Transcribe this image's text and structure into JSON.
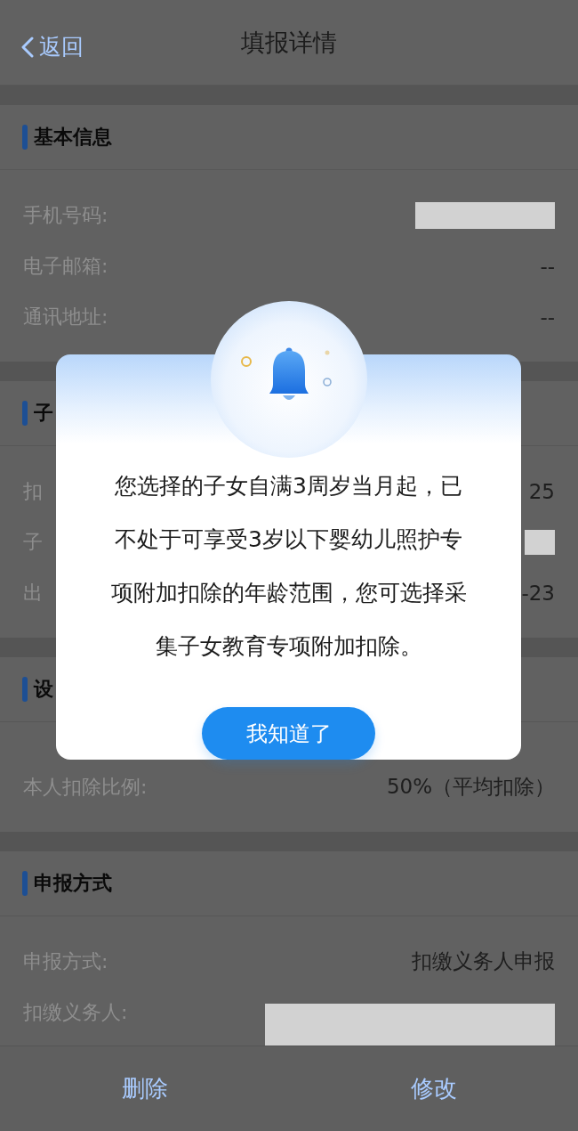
{
  "header": {
    "back_label": "返回",
    "title": "填报详情"
  },
  "sections": [
    {
      "title": "基本信息",
      "rows": [
        {
          "label": "手机号码:",
          "kind": "redacted"
        },
        {
          "label": "电子邮箱:",
          "kind": "text",
          "value": "--"
        },
        {
          "label": "通讯地址:",
          "kind": "text",
          "value": "--"
        }
      ]
    },
    {
      "title": "子",
      "rows": [
        {
          "label": "扣",
          "kind": "text",
          "value": "25"
        },
        {
          "label": "子",
          "kind": "redacted_short"
        },
        {
          "label": "出",
          "kind": "text",
          "value": "-23"
        }
      ]
    },
    {
      "title": "设",
      "rows": [
        {
          "label": "本人扣除比例:",
          "kind": "text",
          "value": "50%（平均扣除）"
        }
      ]
    },
    {
      "title": "申报方式",
      "rows": [
        {
          "label": "申报方式:",
          "kind": "text",
          "value": "扣缴义务人申报"
        },
        {
          "label": "扣缴义务人:",
          "kind": "redacted_wide"
        }
      ]
    }
  ],
  "bottom_actions": [
    "删除",
    "修改"
  ],
  "dialog": {
    "message_lines": [
      "您选择的子女自满3周岁当月起，已",
      "不处于可享受3岁以下婴幼儿照护专",
      "项附加扣除的年龄范围，您可选择采",
      "集子女教育专项附加扣除。"
    ],
    "button": "我知道了"
  }
}
